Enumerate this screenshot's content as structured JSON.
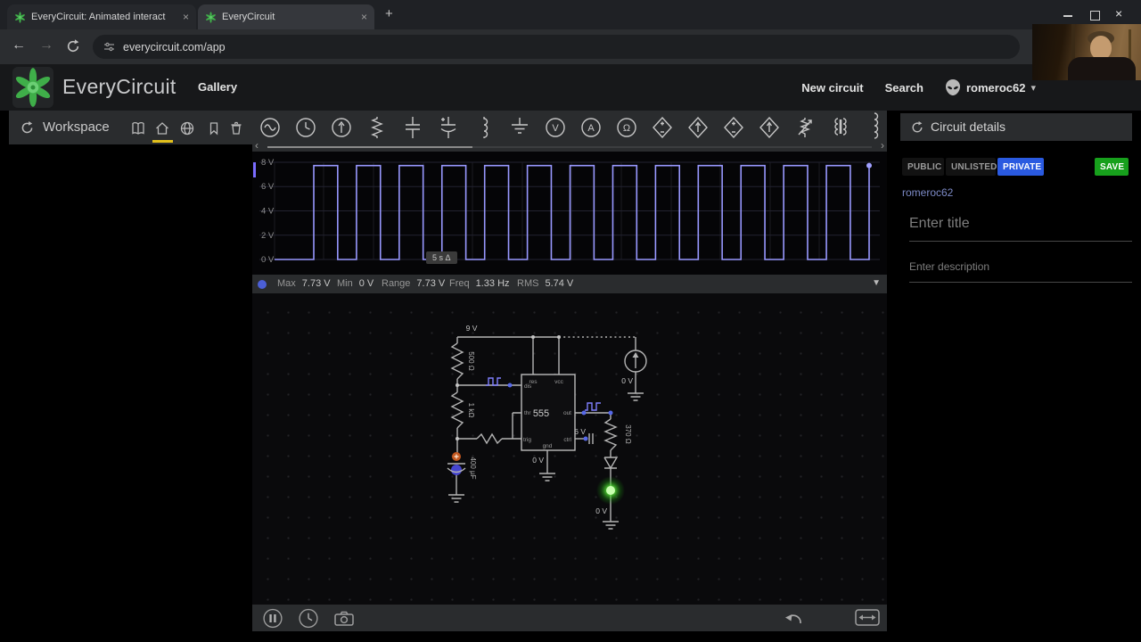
{
  "icons": {
    "back": "←",
    "forward": "→",
    "plus": "+",
    "close": "×",
    "caret_down": "▾",
    "dropdown": "▼",
    "chev_left": "‹",
    "chev_right": "›"
  },
  "browser": {
    "tabs": [
      {
        "title": "EveryCircuit: Animated interact"
      },
      {
        "title": "EveryCircuit"
      }
    ],
    "url": "everycircuit.com/app"
  },
  "header": {
    "app_name": "EveryCircuit",
    "gallery": "Gallery",
    "new_circuit": "New circuit",
    "search": "Search",
    "username": "romeroc62"
  },
  "workspace": {
    "title": "Workspace"
  },
  "components": [
    "ac-voltage-source",
    "clock-source",
    "current-source",
    "resistor",
    "capacitor",
    "polarized-capacitor",
    "inductor",
    "ground",
    "voltmeter",
    "ammeter",
    "ohmmeter",
    "vcvs",
    "vccs",
    "ccvs",
    "cccs",
    "potentiometer",
    "transformer",
    "inductor-large"
  ],
  "scope": {
    "y_labels": [
      "8 V",
      "6 V",
      "4 V",
      "2 V",
      "0 V"
    ],
    "time_marker": "5 s Δ"
  },
  "scope_wave": {
    "cycles": 13,
    "duty": 0.56,
    "high_v": 7.73,
    "low_v": 0,
    "axis_max_v": 8
  },
  "stats": {
    "items": [
      {
        "label": "Max",
        "value": "7.73 V"
      },
      {
        "label": "Min",
        "value": "0 V"
      },
      {
        "label": "Range",
        "value": "7.73 V"
      },
      {
        "label": "Freq",
        "value": "1.33 Hz"
      },
      {
        "label": "RMS",
        "value": "5.74 V"
      }
    ]
  },
  "circuit": {
    "supply": "9 V",
    "r1": "500 Ω",
    "r2": "1 kΩ",
    "c1": "400 µF",
    "ic": "555",
    "r3": "370 Ω",
    "ctrl_node": "6 V",
    "src_node": "0 V",
    "gnd_node": "0 V",
    "led_node": "0 V",
    "pins": {
      "res": "res",
      "dis": "dis",
      "thr": "thr",
      "trig": "trig",
      "vcc": "vcc",
      "out": "out",
      "ctrl": "ctrl",
      "gnd": "gnd"
    }
  },
  "details": {
    "title": "Circuit details",
    "public": "PUBLIC",
    "unlisted": "UNLISTED",
    "private": "PRIVATE",
    "selected_visibility": "PRIVATE",
    "save": "SAVE",
    "author": "romeroc62",
    "title_placeholder": "Enter title",
    "desc_placeholder": "Enter description"
  }
}
